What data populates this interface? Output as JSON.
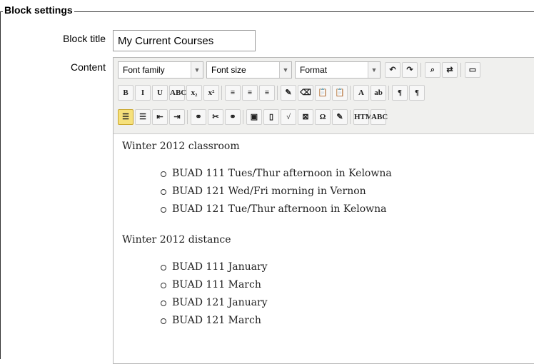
{
  "fieldset": {
    "legend": "Block settings"
  },
  "form": {
    "block_title_label": "Block title",
    "block_title_value": "My Current Courses",
    "content_label": "Content"
  },
  "toolbar": {
    "font_family": "Font family",
    "font_size": "Font size",
    "format": "Format",
    "row2": [
      "B",
      "I",
      "U",
      "ABC",
      "x₂",
      "x²",
      "≡",
      "≡",
      "≡",
      "✎",
      "⌫",
      "📋",
      "📋",
      "A",
      "ab",
      "¶",
      "¶"
    ],
    "row3": [
      "☰",
      "☰",
      "⇤",
      "⇥",
      "⚭",
      "✂",
      "⚭",
      "▣",
      "▯",
      "√",
      "⊠",
      "Ω",
      "✎",
      "HTML",
      "ABC"
    ]
  },
  "editor_content": {
    "heading1": "Winter 2012 classroom",
    "list1": [
      "BUAD 111 Tues/Thur afternoon in Kelowna",
      "BUAD 121 Wed/Fri morning in Vernon",
      "BUAD 121 Tue/Thur afternoon in Kelowna"
    ],
    "heading2": "Winter 2012 distance",
    "list2": [
      "BUAD 111 January",
      "BUAD 111 March",
      "BUAD 121 January",
      "BUAD 121 March"
    ]
  }
}
